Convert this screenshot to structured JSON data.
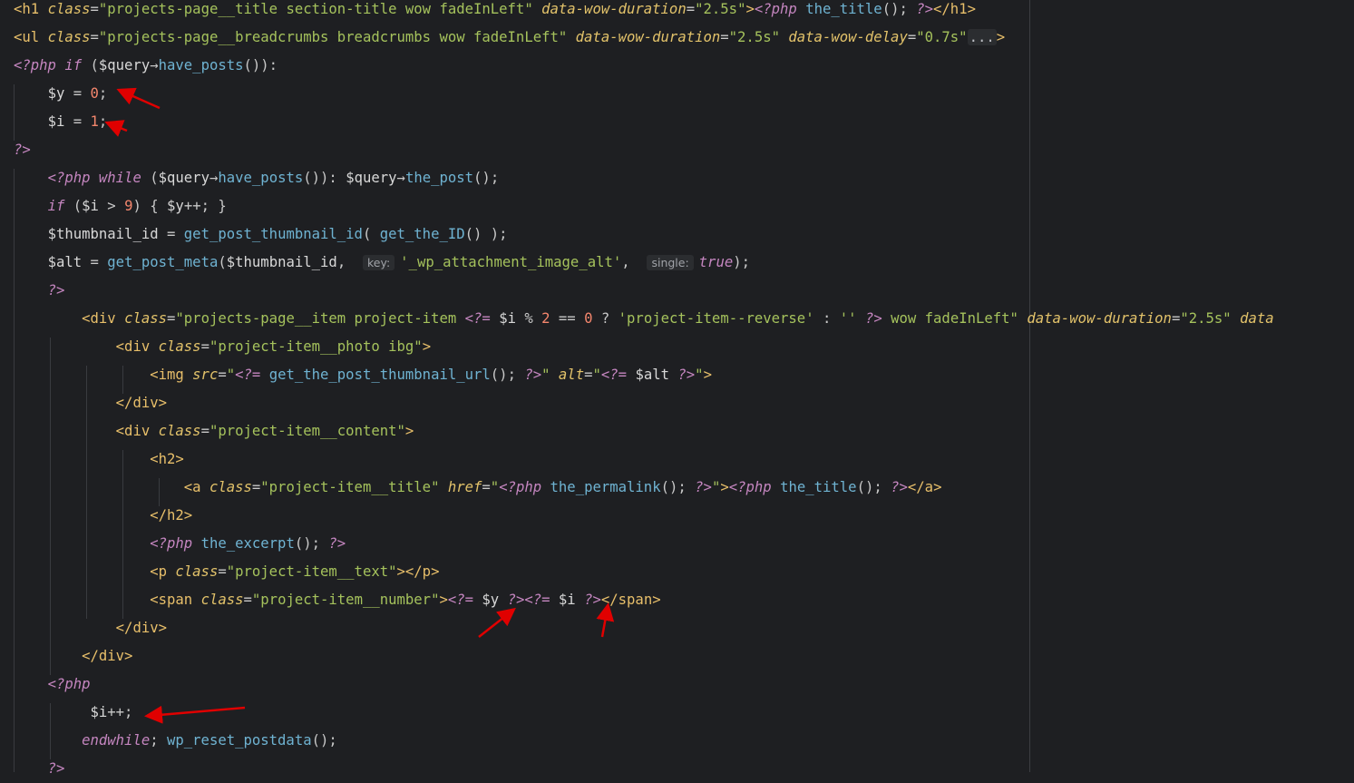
{
  "editor": {
    "language": "php",
    "lines": [
      {
        "id": "l1"
      },
      {
        "id": "l2"
      },
      {
        "id": "l3"
      }
    ],
    "texts": {
      "h1_class": "projects-page__title section-title wow fadeInLeft",
      "dur": "2.5s",
      "the_title": "the_title",
      "ul_class": "projects-page__breadcrumbs breadcrumbs wow fadeInLeft",
      "delay": "0.7s",
      "fold": "...",
      "query_have_posts": "have_posts",
      "y0": "$y",
      "zero": "0",
      "i1": "$i",
      "one": "1",
      "the_post": "the_post",
      "nine": "9",
      "thumb_var": "$thumbnail_id",
      "get_thumb": "get_post_thumbnail_id",
      "get_id": "get_the_ID",
      "alt_var": "$alt",
      "get_meta": "get_post_meta",
      "hint_key": "key:",
      "meta_key": "'_wp_attachment_image_alt'",
      "hint_single": "single:",
      "true_kw": "true",
      "div_item_class": "projects-page__item project-item",
      "two": "2",
      "reverse": "'project-item--reverse'",
      "empty_str": "''",
      "wow_item": " wow fadeInLeft",
      "data_trunc": "data",
      "photo_class": "project-item__photo ibg",
      "thumb_url": "get_the_post_thumbnail_url",
      "content_class": "project-item__content",
      "title_class": "project-item__title",
      "permalink": "the_permalink",
      "excerpt": "the_excerpt",
      "text_class": "project-item__text",
      "number_class": "project-item__number",
      "endwhile": "endwhile",
      "reset": "wp_reset_postdata"
    }
  },
  "annotations": {
    "arrow_color": "#e00000",
    "count": 6
  },
  "colors": {
    "background": "#1e1f22",
    "indent_guide": "#393b40"
  }
}
